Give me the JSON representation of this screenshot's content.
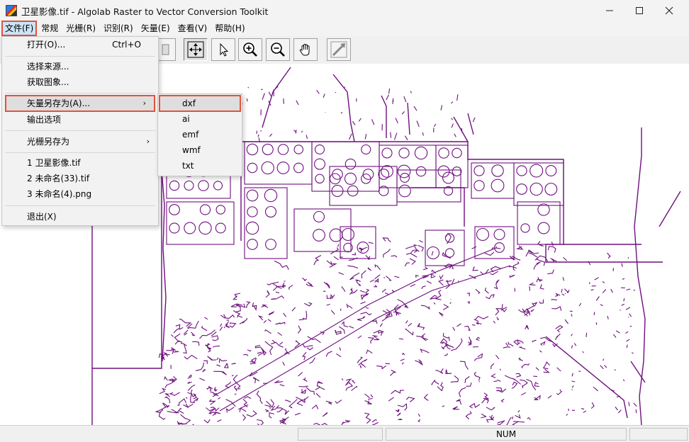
{
  "window": {
    "title": "卫星影像.tif - Algolab Raster to Vector Conversion Toolkit",
    "icon": "app-raster-icon"
  },
  "menubar": {
    "items": [
      {
        "label": "文件(F)",
        "active": true
      },
      {
        "label": "常规"
      },
      {
        "label": "光栅(R)"
      },
      {
        "label": "识别(R)"
      },
      {
        "label": "矢量(E)"
      },
      {
        "label": "查看(V)"
      },
      {
        "label": "帮助(H)"
      }
    ]
  },
  "toolbar": {
    "buttons": [
      "fit-window-icon",
      "pointer-icon",
      "zoom-in-icon",
      "zoom-out-icon",
      "pan-hand-icon",
      "vectorize-icon"
    ]
  },
  "file_menu": {
    "open": {
      "label": "打开(O)...",
      "shortcut": "Ctrl+O"
    },
    "select_source": {
      "label": "选择来源..."
    },
    "acquire_image": {
      "label": "获取图象..."
    },
    "save_vector_as": {
      "label": "矢量另存为(A)...",
      "arrow": "›"
    },
    "output_options": {
      "label": "输出选项"
    },
    "save_raster_as": {
      "label": "光栅另存为",
      "arrow": "›"
    },
    "recent_1": {
      "label": "1 卫星影像.tif"
    },
    "recent_2": {
      "label": "2 未命名(33).tif"
    },
    "recent_3": {
      "label": "3 未命名(4).png"
    },
    "exit": {
      "label": "退出(X)"
    }
  },
  "vector_submenu": {
    "items": [
      "dxf",
      "ai",
      "emf",
      "wmf",
      "txt"
    ],
    "highlighted": "dxf"
  },
  "statusbar": {
    "num": "NUM"
  },
  "colors": {
    "vector_stroke": "#6e0f7e",
    "highlight_outline": "#e0533d"
  }
}
